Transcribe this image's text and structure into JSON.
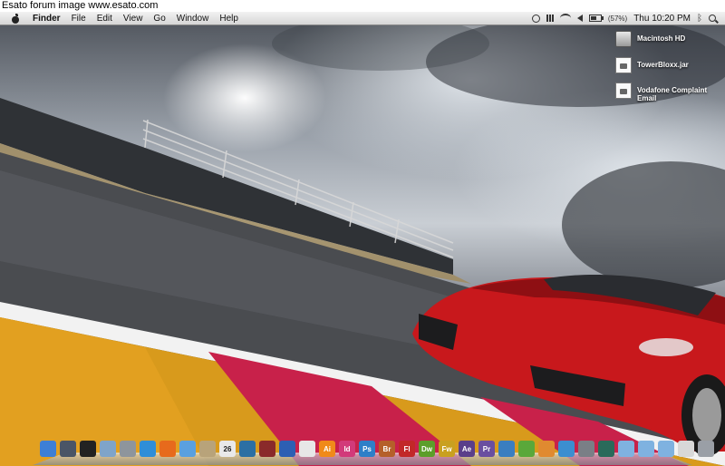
{
  "forum_banner": "Esato forum image www.esato.com",
  "menubar": {
    "app_name": "Finder",
    "items": [
      "File",
      "Edit",
      "View",
      "Go",
      "Window",
      "Help"
    ],
    "battery_percent": "(57%)",
    "clock": "Thu 10:20 PM"
  },
  "desktop": {
    "icons": [
      {
        "label": "Macintosh HD",
        "icon": "hard-drive-icon"
      },
      {
        "label": "TowerBloxx.jar",
        "icon": "jar-file-icon"
      },
      {
        "label": "Vodafone Complaint Email",
        "icon": "email-document-icon"
      }
    ]
  },
  "dock": {
    "apps": [
      {
        "name": "finder",
        "text": "",
        "color": "#3d7fd6"
      },
      {
        "name": "dashboard-widgets",
        "text": "",
        "color": "#4a5566"
      },
      {
        "name": "dashboard",
        "text": "",
        "color": "#222222"
      },
      {
        "name": "preview",
        "text": "",
        "color": "#7fa4c9"
      },
      {
        "name": "system-utility",
        "text": "",
        "color": "#8e959c"
      },
      {
        "name": "safari",
        "text": "",
        "color": "#2f8ed8"
      },
      {
        "name": "firefox",
        "text": "",
        "color": "#e76a1c"
      },
      {
        "name": "itunes",
        "text": "",
        "color": "#5aa0e0"
      },
      {
        "name": "photo-app",
        "text": "",
        "color": "#b8a37a"
      },
      {
        "name": "ical",
        "text": "26",
        "color": "#e9e9e9"
      },
      {
        "name": "iphoto",
        "text": "",
        "color": "#2c6fa3"
      },
      {
        "name": "photo-booth",
        "text": "",
        "color": "#8a2a2a"
      },
      {
        "name": "bluetooth-file-exchange",
        "text": "",
        "color": "#2d5fb3"
      },
      {
        "name": "acrobat",
        "text": "",
        "color": "#e7e7e7"
      },
      {
        "name": "illustrator",
        "text": "Ai",
        "color": "#f08a1a"
      },
      {
        "name": "indesign",
        "text": "Id",
        "color": "#d23a7a"
      },
      {
        "name": "photoshop",
        "text": "Ps",
        "color": "#2e7fc8"
      },
      {
        "name": "bridge",
        "text": "Br",
        "color": "#b5602a"
      },
      {
        "name": "flash",
        "text": "Fl",
        "color": "#c22828"
      },
      {
        "name": "dreamweaver",
        "text": "Dw",
        "color": "#5c9e2a"
      },
      {
        "name": "fireworks",
        "text": "Fw",
        "color": "#c9a020"
      },
      {
        "name": "after-effects",
        "text": "Ae",
        "color": "#5a3f8a"
      },
      {
        "name": "premiere",
        "text": "Pr",
        "color": "#6a4fa0"
      },
      {
        "name": "app-blue",
        "text": "",
        "color": "#3a7ec0"
      },
      {
        "name": "app-green",
        "text": "",
        "color": "#5aa83a"
      },
      {
        "name": "app-orange",
        "text": "",
        "color": "#e08a30"
      },
      {
        "name": "app-blue-2",
        "text": "",
        "color": "#3c8ed0"
      },
      {
        "name": "system-preferences",
        "text": "",
        "color": "#7a7f86"
      },
      {
        "name": "time-machine",
        "text": "",
        "color": "#2a6a5a"
      },
      {
        "name": "applications-folder",
        "text": "",
        "color": "#7fb2e0"
      },
      {
        "name": "documents-folder",
        "text": "",
        "color": "#7fb2e0"
      },
      {
        "name": "downloads-folder",
        "text": "",
        "color": "#7fb2e0"
      },
      {
        "name": "mail-document",
        "text": "",
        "color": "#d8d8d8"
      },
      {
        "name": "trash",
        "text": "",
        "color": "#9a9fa6"
      }
    ]
  }
}
